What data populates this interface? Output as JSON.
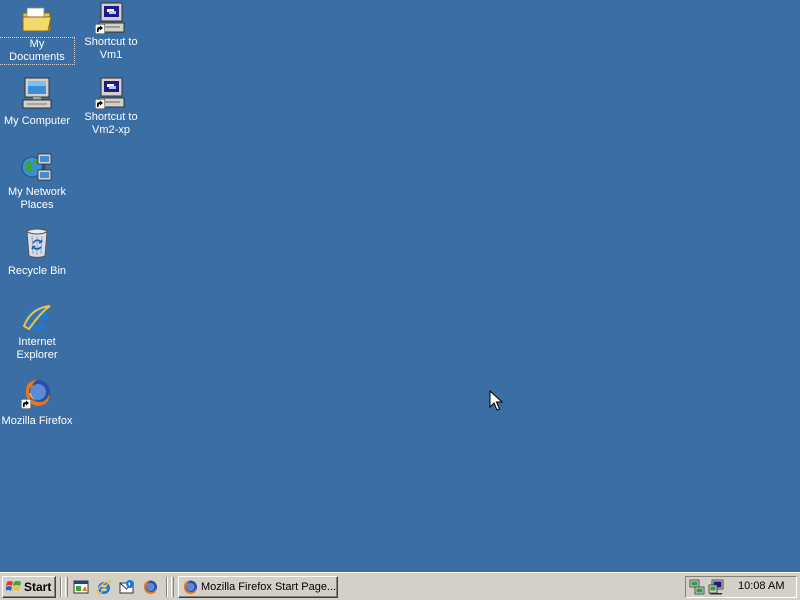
{
  "desktop": {
    "background_color": "#3a6ea5",
    "icons": [
      {
        "id": "my-documents",
        "label": "My Documents",
        "icon": "folder-icon",
        "selected": true
      },
      {
        "id": "my-computer",
        "label": "My Computer",
        "icon": "computer-icon"
      },
      {
        "id": "my-network-places",
        "label": "My Network Places",
        "icon": "network-globe-icon"
      },
      {
        "id": "recycle-bin",
        "label": "Recycle Bin",
        "icon": "recycle-bin-icon"
      },
      {
        "id": "internet-explorer",
        "label": "Internet Explorer",
        "icon": "internet-explorer-icon"
      },
      {
        "id": "mozilla-firefox",
        "label": "Mozilla Firefox",
        "icon": "firefox-icon",
        "shortcut": true
      },
      {
        "id": "shortcut-vm1",
        "label": "Shortcut to Vm1",
        "icon": "remote-desktop-icon",
        "shortcut": true
      },
      {
        "id": "shortcut-vm2-xp",
        "label": "Shortcut to Vm2-xp",
        "icon": "remote-desktop-icon",
        "shortcut": true
      }
    ]
  },
  "taskbar": {
    "start_label": "Start",
    "quick_launch": [
      {
        "icon": "show-desktop-icon"
      },
      {
        "icon": "internet-explorer-icon"
      },
      {
        "icon": "outlook-express-icon"
      },
      {
        "icon": "firefox-icon"
      }
    ],
    "tasks": [
      {
        "label": "Mozilla Firefox Start Page...",
        "icon": "firefox-icon"
      }
    ],
    "tray": {
      "icons": [
        "network-connection-icon",
        "network-monitor-icon"
      ],
      "clock": "10:08 AM"
    }
  }
}
